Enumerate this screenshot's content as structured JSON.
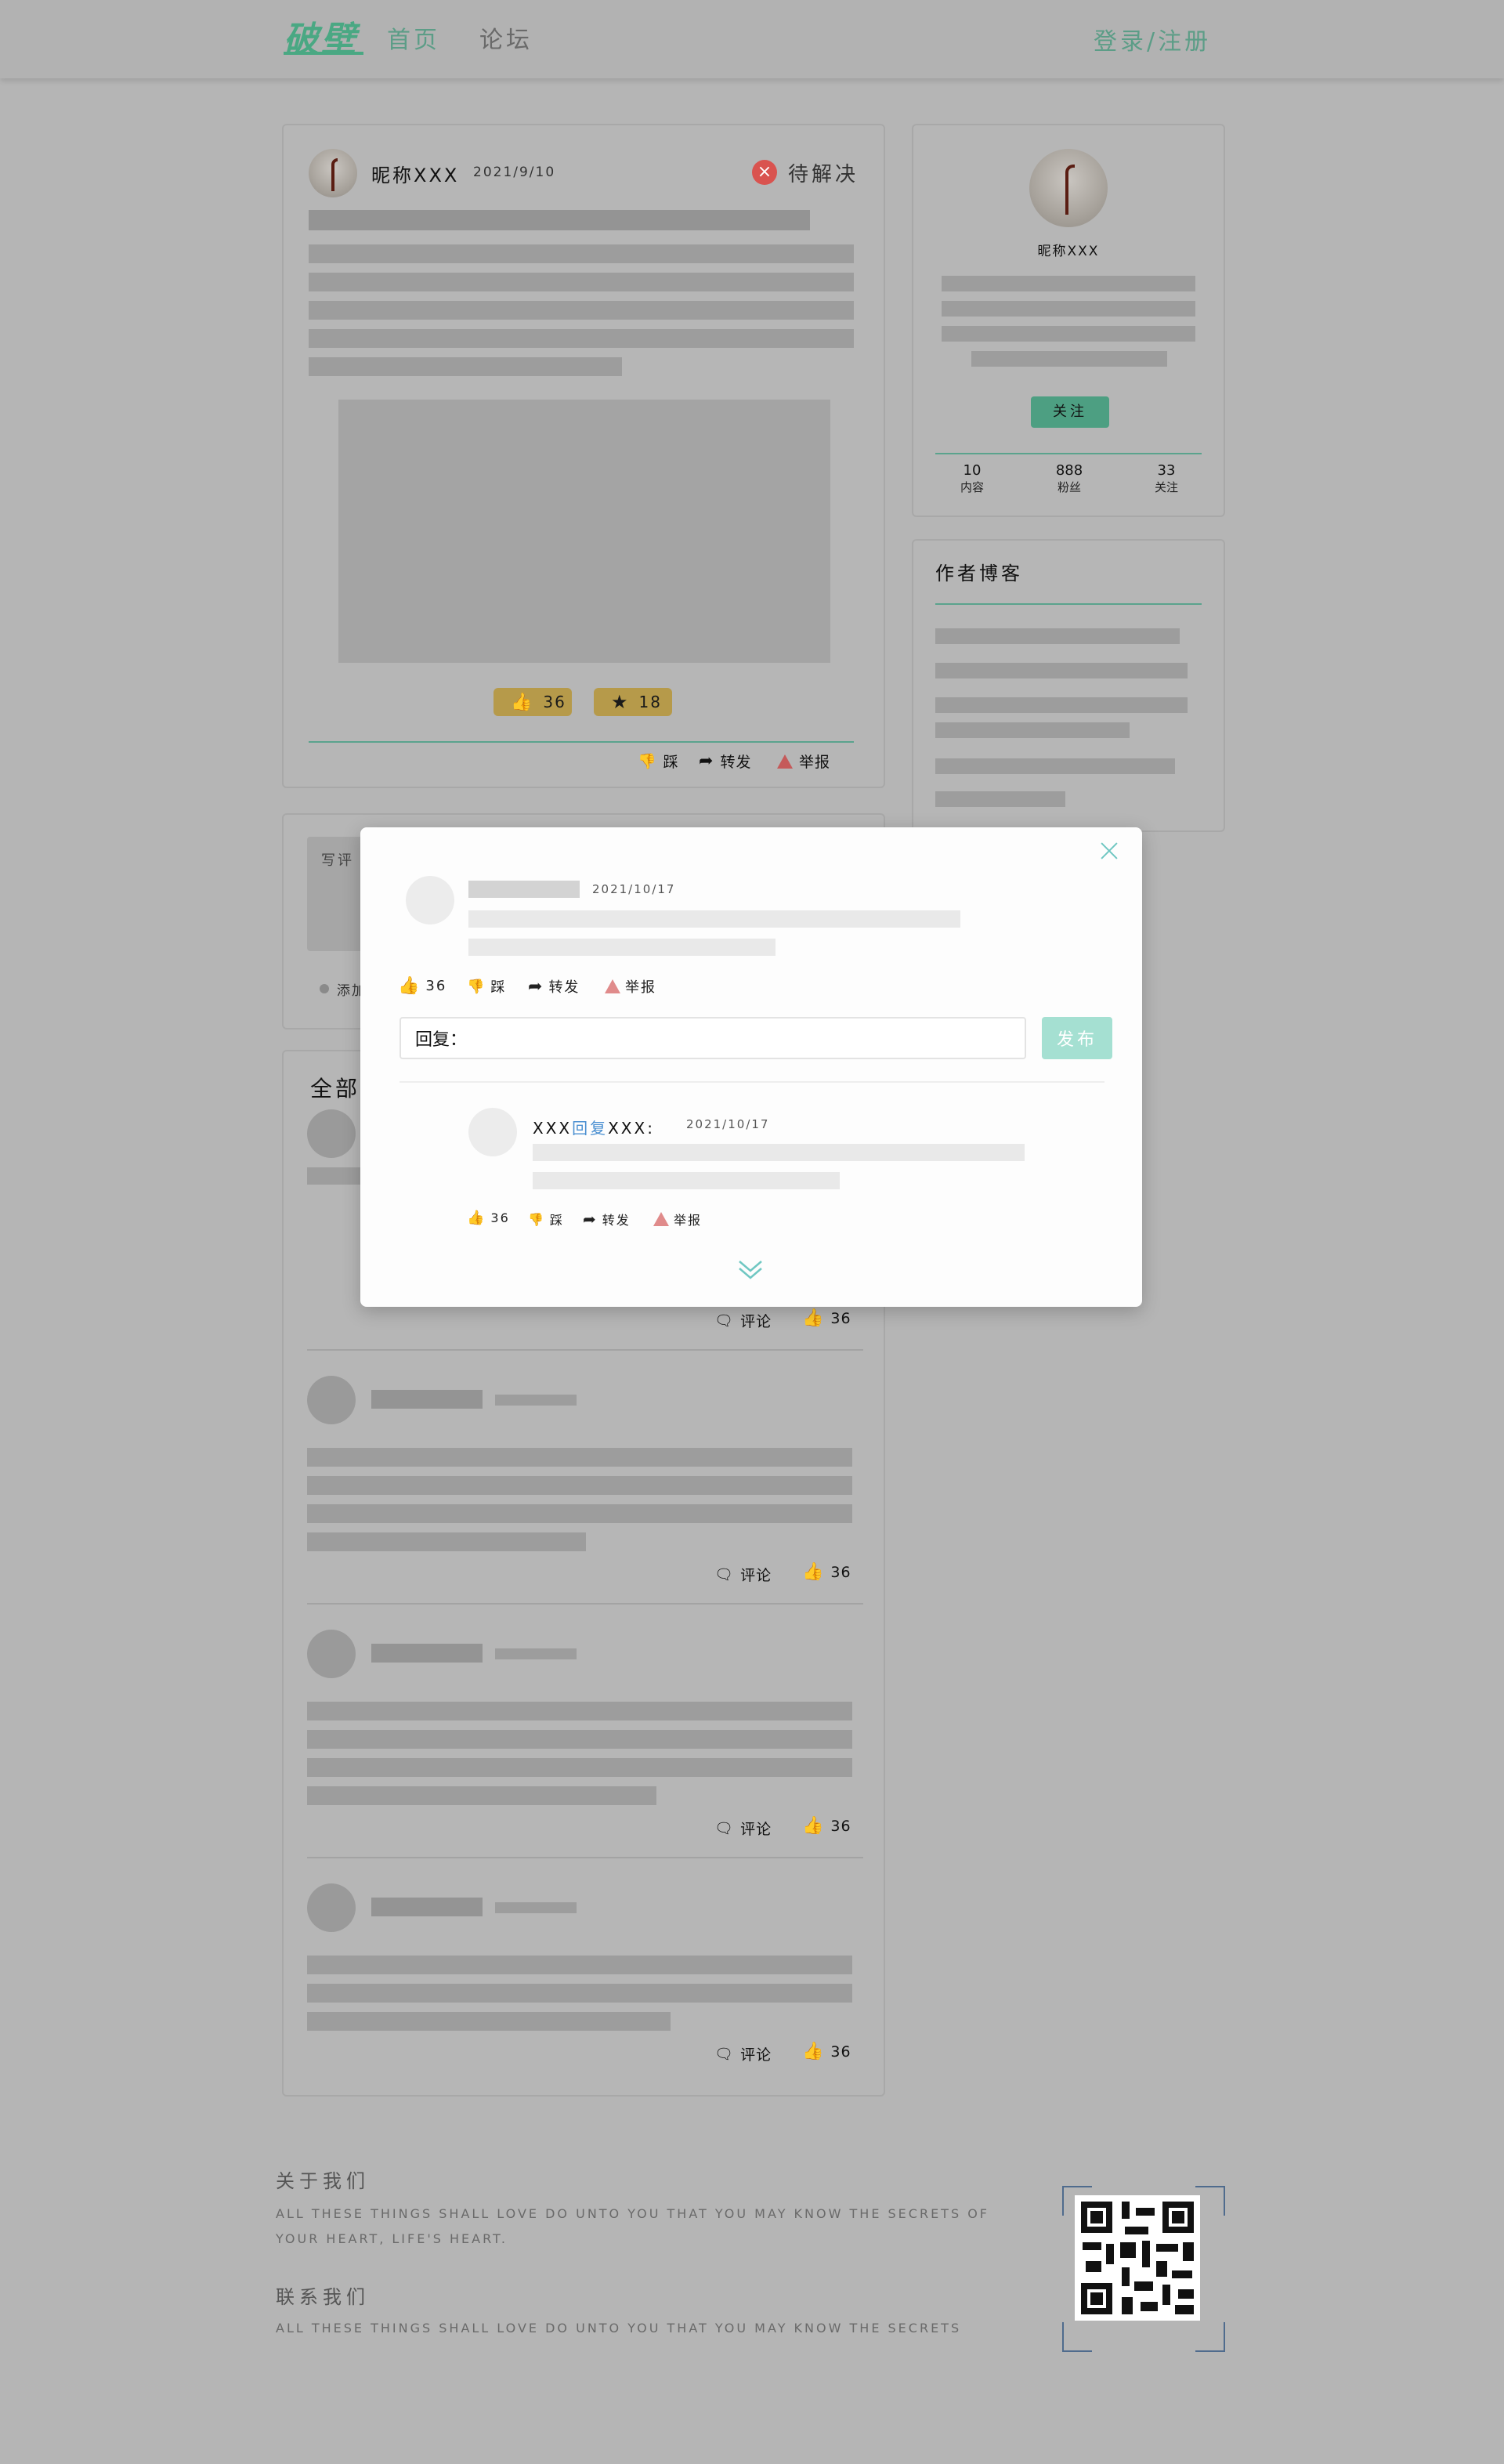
{
  "nav": {
    "logo": "破壁",
    "home": "首页",
    "forum": "论坛",
    "login_register": "登录/注册"
  },
  "post": {
    "author": "昵称XXX",
    "date": "2021/9/10",
    "status": "待解决",
    "like_count": "36",
    "favorite_count": "18",
    "actions": {
      "dislike": "踩",
      "share": "转发",
      "report": "举报"
    }
  },
  "comment_box": {
    "placeholder": "写评",
    "add_label": "添加"
  },
  "comments_section": {
    "title": "全部评论",
    "items": [
      {
        "comment_label": "评论",
        "like_count": "36"
      },
      {
        "comment_label": "评论",
        "like_count": "36"
      },
      {
        "comment_label": "评论",
        "like_count": "36"
      },
      {
        "comment_label": "评论",
        "like_count": "36"
      }
    ]
  },
  "author_card": {
    "name": "昵称XXX",
    "follow_button": "关注",
    "stats": [
      {
        "value": "10",
        "label": "内容"
      },
      {
        "value": "888",
        "label": "粉丝"
      },
      {
        "value": "33",
        "label": "关注"
      }
    ]
  },
  "blog_card": {
    "title": "作者博客"
  },
  "modal": {
    "comment": {
      "date": "2021/10/17",
      "like_count": "36",
      "dislike": "踩",
      "share": "转发",
      "report": "举报"
    },
    "reply_label": "回复：",
    "publish_button": "发布",
    "reply": {
      "from": "XXX",
      "reply_word": "回复",
      "to": "XXX:",
      "date": "2021/10/17",
      "like_count": "36",
      "dislike": "踩",
      "share": "转发",
      "report": "举报"
    },
    "expand_icon": "double-chevron-down-icon"
  },
  "footer": {
    "about_title": "关于我们",
    "about_text": "ALL THESE THINGS SHALL LOVE DO UNTO YOU THAT YOU MAY KNOW THE SECRETS OF YOUR HEART, LIFE'S HEART.",
    "contact_title": "联系我们",
    "contact_text": "ALL THESE THINGS SHALL LOVE DO UNTO YOU THAT YOU MAY KNOW THE SECRETS"
  },
  "colors": {
    "brand_green": "#4aa883",
    "status_red": "#d9534f",
    "gold": "#b69a4a",
    "publish_teal": "#a5e0d2"
  }
}
